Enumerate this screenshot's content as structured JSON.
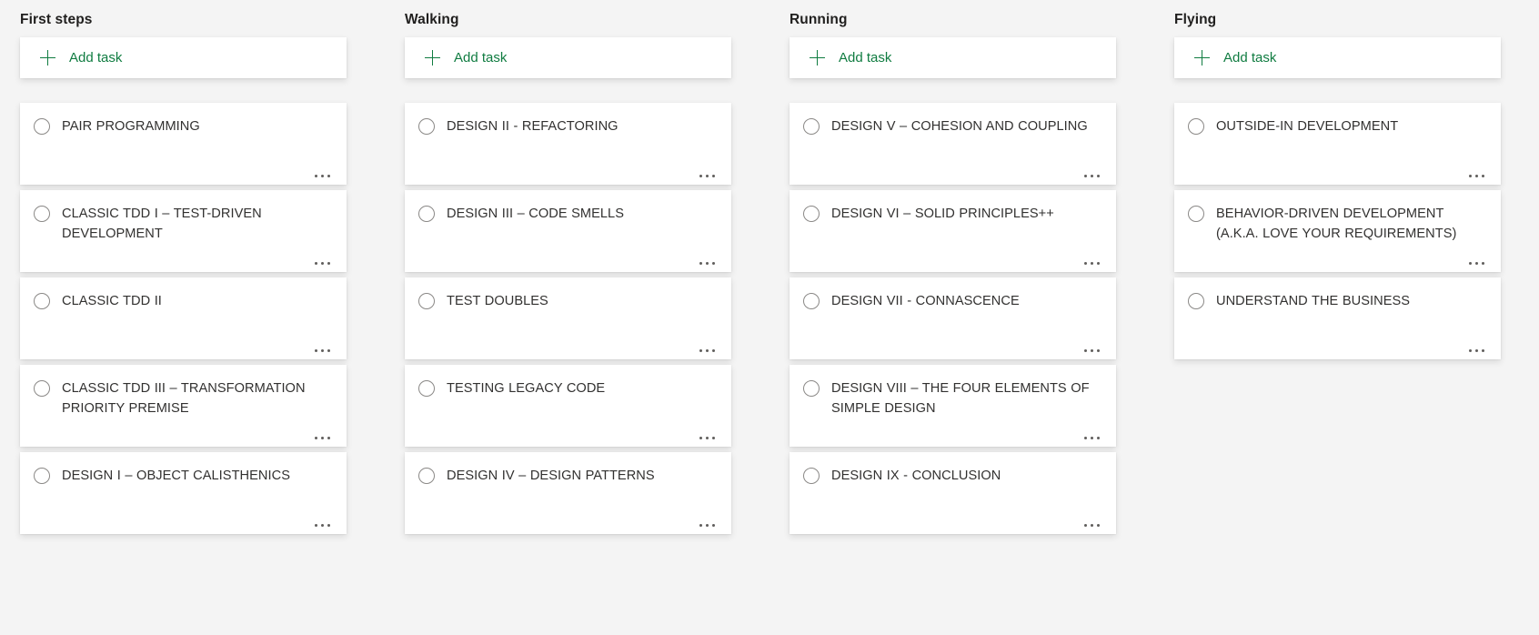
{
  "board": {
    "add_task_label": "Add task",
    "plus_icon": "plus-icon",
    "more_icon": "ellipsis-icon",
    "checkbox_icon": "circle-checkbox-icon",
    "colors": {
      "accent_green": "#107c41",
      "card_background": "#ffffff",
      "board_background": "#f4f4f4",
      "title_text": "#323130",
      "header_text": "#201f1e",
      "checkbox_border": "#8a8886"
    },
    "buckets": [
      {
        "name": "First steps",
        "tasks": [
          {
            "title": "PAIR PROGRAMMING"
          },
          {
            "title": "CLASSIC TDD I – TEST-DRIVEN DEVELOPMENT"
          },
          {
            "title": "CLASSIC TDD II"
          },
          {
            "title": "CLASSIC TDD III – TRANSFORMATION PRIORITY PREMISE"
          },
          {
            "title": "DESIGN I – OBJECT CALISTHENICS"
          }
        ]
      },
      {
        "name": "Walking",
        "tasks": [
          {
            "title": "DESIGN II - REFACTORING"
          },
          {
            "title": "DESIGN III – CODE SMELLS"
          },
          {
            "title": "TEST DOUBLES"
          },
          {
            "title": "TESTING LEGACY CODE"
          },
          {
            "title": "DESIGN IV – DESIGN PATTERNS"
          }
        ]
      },
      {
        "name": "Running",
        "tasks": [
          {
            "title": "DESIGN V – COHESION AND COUPLING"
          },
          {
            "title": "DESIGN VI – SOLID PRINCIPLES++"
          },
          {
            "title": "DESIGN VII - CONNASCENCE"
          },
          {
            "title": "DESIGN VIII – THE FOUR ELEMENTS OF SIMPLE DESIGN"
          },
          {
            "title": "DESIGN IX - CONCLUSION"
          }
        ]
      },
      {
        "name": "Flying",
        "tasks": [
          {
            "title": "OUTSIDE-IN DEVELOPMENT"
          },
          {
            "title": "BEHAVIOR-DRIVEN DEVELOPMENT (A.K.A. LOVE YOUR REQUIREMENTS)"
          },
          {
            "title": "UNDERSTAND THE BUSINESS"
          }
        ]
      }
    ]
  }
}
